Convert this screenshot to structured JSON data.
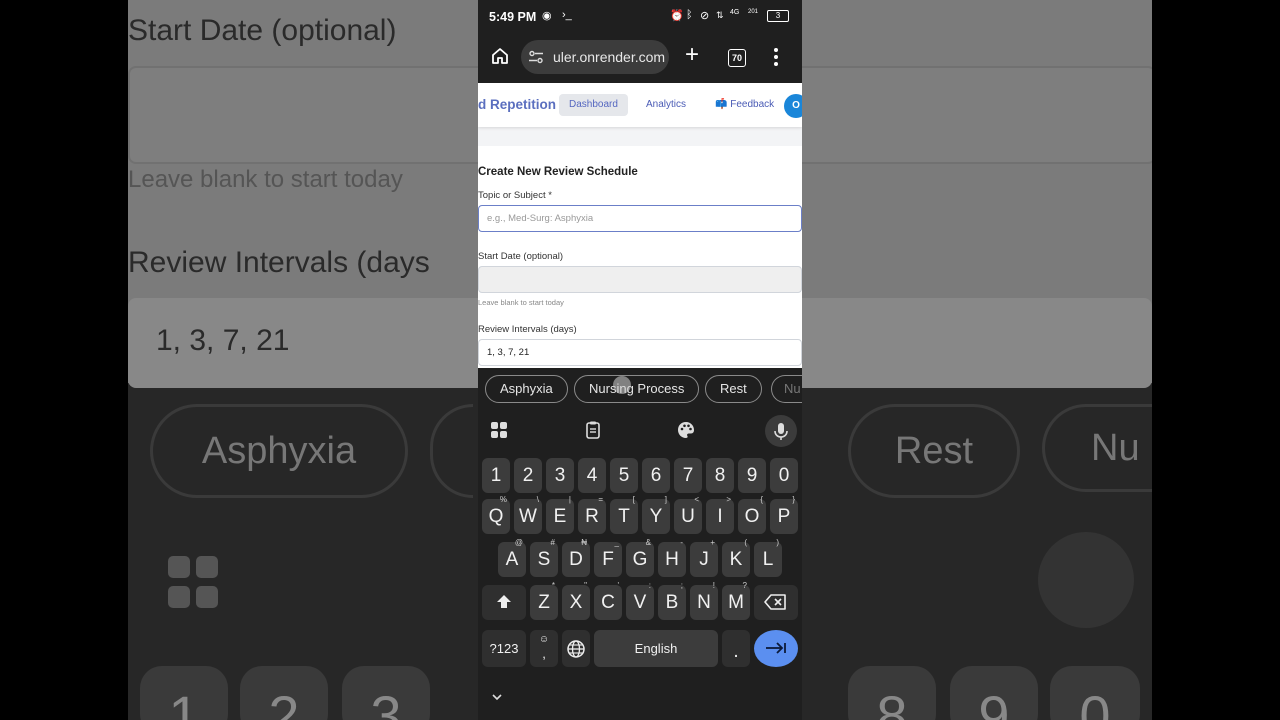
{
  "status_bar": {
    "time": "5:49 PM",
    "battery": "3"
  },
  "browser": {
    "url": "uler.onrender.com",
    "tab_count": "70"
  },
  "site": {
    "brand": "d Repetition",
    "nav": {
      "dashboard": "Dashboard",
      "analytics": "Analytics",
      "feedback": "Feedback",
      "circle": "O"
    }
  },
  "form": {
    "title": "Create New Review Schedule",
    "topic_label": "Topic or Subject *",
    "topic_placeholder": "e.g., Med-Surg: Asphyxia",
    "start_label": "Start Date (optional)",
    "start_hint": "Leave blank to start today",
    "intervals_label": "Review Intervals (days)",
    "intervals_value": "1, 3, 7, 21"
  },
  "suggestions": [
    "Asphyxia",
    "Nursing Process",
    "Rest",
    "Nu"
  ],
  "keyboard": {
    "numbers": [
      "1",
      "2",
      "3",
      "4",
      "5",
      "6",
      "7",
      "8",
      "9",
      "0"
    ],
    "row1": [
      {
        "k": "Q",
        "s": "%"
      },
      {
        "k": "W",
        "s": "\\"
      },
      {
        "k": "E",
        "s": "|"
      },
      {
        "k": "R",
        "s": "="
      },
      {
        "k": "T",
        "s": "["
      },
      {
        "k": "Y",
        "s": "]"
      },
      {
        "k": "U",
        "s": "<"
      },
      {
        "k": "I",
        "s": ">"
      },
      {
        "k": "O",
        "s": "{"
      },
      {
        "k": "P",
        "s": "}"
      }
    ],
    "row2": [
      {
        "k": "A",
        "s": "@"
      },
      {
        "k": "S",
        "s": "#"
      },
      {
        "k": "D",
        "s": "₦"
      },
      {
        "k": "F",
        "s": "_"
      },
      {
        "k": "G",
        "s": "&"
      },
      {
        "k": "H",
        "s": "-"
      },
      {
        "k": "J",
        "s": "+"
      },
      {
        "k": "K",
        "s": "("
      },
      {
        "k": "L",
        "s": ")"
      }
    ],
    "row3": [
      {
        "k": "Z",
        "s": "*"
      },
      {
        "k": "X",
        "s": "\""
      },
      {
        "k": "C",
        "s": "'"
      },
      {
        "k": "V",
        "s": ":"
      },
      {
        "k": "B",
        "s": ";"
      },
      {
        "k": "N",
        "s": "!"
      },
      {
        "k": "M",
        "s": "?"
      }
    ],
    "symbols_key": "?123",
    "comma_key": ",",
    "space_key": "English",
    "period_key": ".",
    "icons": {
      "shift": "shift-icon",
      "backspace": "backspace-icon",
      "enter": "next-arrow-icon",
      "globe": "globe-icon",
      "mic": "mic-icon"
    }
  },
  "background_zoom": {
    "start_label": "Start Date (optional)",
    "hint": "Leave blank to start today",
    "intervals_label": "Review Intervals (days",
    "intervals_value": "1, 3, 7, 21",
    "chip_1": "Asphyxia",
    "chip_2": "Rest",
    "chip_3": "Nu",
    "keys": [
      "1",
      "2",
      "3",
      "8",
      "9",
      "0"
    ]
  },
  "colors": {
    "accent": "#5b8ff0",
    "brand": "#5b6fbf",
    "key_bg": "#3c3c3c",
    "keyboard_bg": "#1f1f1f"
  }
}
